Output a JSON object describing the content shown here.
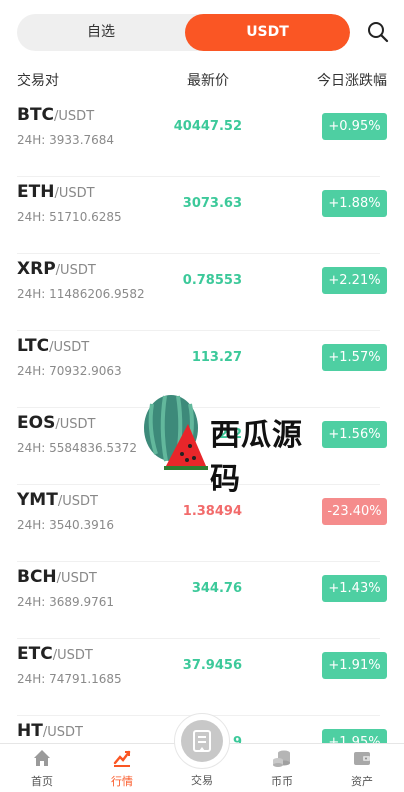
{
  "top": {
    "fav_label": "自选",
    "usdt_label": "USDT"
  },
  "header": {
    "pair": "交易对",
    "price": "最新价",
    "change": "今日涨跌幅"
  },
  "rows": [
    {
      "base": "BTC",
      "quote": "/USDT",
      "vol": "24H: 3933.7684",
      "price": "40447.52",
      "change": "+0.95%",
      "dir": "up"
    },
    {
      "base": "ETH",
      "quote": "/USDT",
      "vol": "24H: 51710.6285",
      "price": "3073.63",
      "change": "+1.88%",
      "dir": "up"
    },
    {
      "base": "XRP",
      "quote": "/USDT",
      "vol": "24H: 11486206.9582",
      "price": "0.78553",
      "change": "+2.21%",
      "dir": "up"
    },
    {
      "base": "LTC",
      "quote": "/USDT",
      "vol": "24H: 70932.9063",
      "price": "113.27",
      "change": "+1.57%",
      "dir": "up"
    },
    {
      "base": "EOS",
      "quote": "/USDT",
      "vol": "24H: 5584836.5372",
      "price": "2.2",
      "change": "+1.56%",
      "dir": "up"
    },
    {
      "base": "YMT",
      "quote": "/USDT",
      "vol": "24H: 3540.3916",
      "price": "1.38494",
      "change": "-23.40%",
      "dir": "down"
    },
    {
      "base": "BCH",
      "quote": "/USDT",
      "vol": "24H: 3689.9761",
      "price": "344.76",
      "change": "+1.43%",
      "dir": "up"
    },
    {
      "base": "ETC",
      "quote": "/USDT",
      "vol": "24H: 74791.1685",
      "price": "37.9456",
      "change": "+1.91%",
      "dir": "up"
    },
    {
      "base": "HT",
      "quote": "/USDT",
      "vol": "",
      "price": "9",
      "change": "+1.95%",
      "dir": "up"
    }
  ],
  "watermark": {
    "text": "西瓜源码"
  },
  "tabs": [
    {
      "label": "首页",
      "icon": "home-icon"
    },
    {
      "label": "行情",
      "icon": "chart-icon"
    },
    {
      "label": "交易",
      "icon": "trade-icon"
    },
    {
      "label": "币币",
      "icon": "coins-icon"
    },
    {
      "label": "资产",
      "icon": "wallet-icon"
    }
  ],
  "colors": {
    "accent": "#fa5624",
    "up": "#3cc99a",
    "up_badge": "#4ecfa2",
    "down": "#f26b6b",
    "down_badge": "#f58c8c"
  }
}
